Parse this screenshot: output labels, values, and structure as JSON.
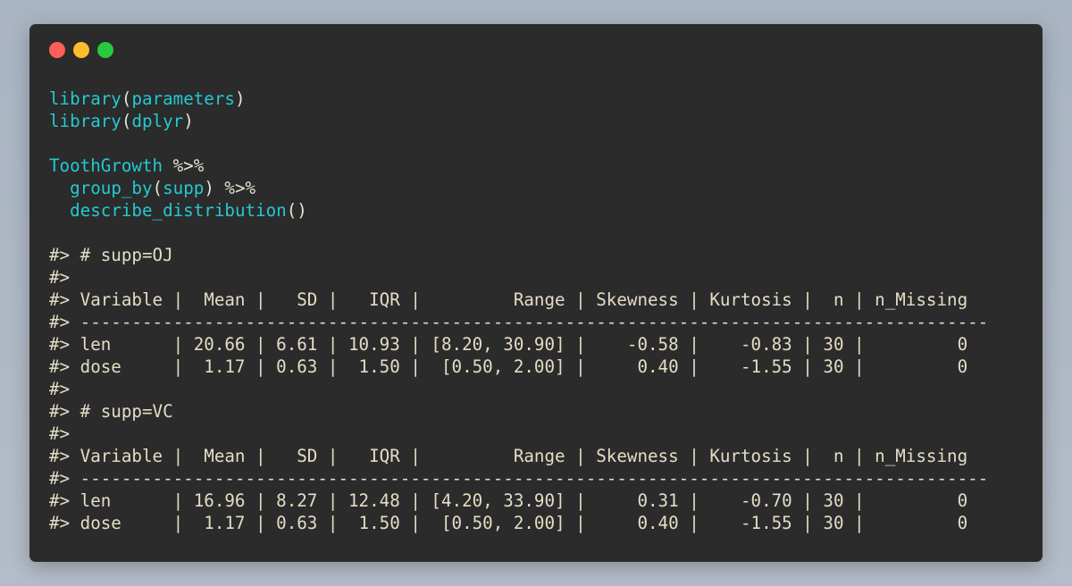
{
  "window": {
    "traffic_lights": [
      {
        "name": "close",
        "color": "#ff5f56"
      },
      {
        "name": "minimize",
        "color": "#ffbd2e"
      },
      {
        "name": "zoom",
        "color": "#27c93f"
      }
    ]
  },
  "colors": {
    "function": "#24c9d2",
    "text": "#e8e3d4",
    "background": "#2b2b2b"
  },
  "code": {
    "l1": {
      "fn": "library",
      "open": "(",
      "arg": "parameters",
      "close": ")"
    },
    "l2": {
      "fn": "library",
      "open": "(",
      "arg": "dplyr",
      "close": ")"
    },
    "l4": {
      "obj": "ToothGrowth",
      "pipe": " %>%"
    },
    "l5": {
      "indent": "  ",
      "fn": "group_by",
      "open": "(",
      "arg": "supp",
      "close": ")",
      "pipe": " %>%"
    },
    "l6": {
      "indent": "  ",
      "fn": "describe_distribution",
      "paren": "()"
    }
  },
  "output": [
    "#> # supp=OJ",
    "#>",
    "#> Variable |  Mean |   SD |   IQR |         Range | Skewness | Kurtosis |  n | n_Missing",
    "#> ----------------------------------------------------------------------------------------",
    "#> len      | 20.66 | 6.61 | 10.93 | [8.20, 30.90] |    -0.58 |    -0.83 | 30 |         0",
    "#> dose     |  1.17 | 0.63 |  1.50 |  [0.50, 2.00] |     0.40 |    -1.55 | 30 |         0",
    "#>",
    "#> # supp=VC",
    "#>",
    "#> Variable |  Mean |   SD |   IQR |         Range | Skewness | Kurtosis |  n | n_Missing",
    "#> ----------------------------------------------------------------------------------------",
    "#> len      | 16.96 | 8.27 | 12.48 | [4.20, 33.90] |     0.31 |    -0.70 | 30 |         0",
    "#> dose     |  1.17 | 0.63 |  1.50 |  [0.50, 2.00] |     0.40 |    -1.55 | 30 |         0"
  ]
}
